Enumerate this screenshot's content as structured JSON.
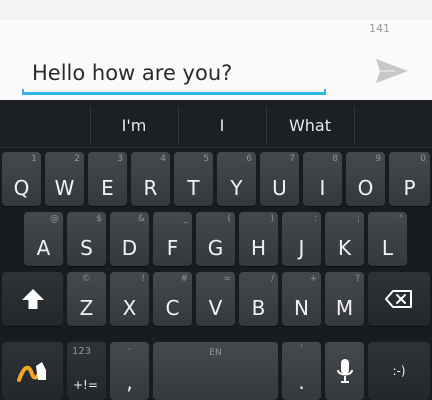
{
  "compose": {
    "char_counter": "141",
    "message_text": "Hello how are you?",
    "send_icon": "send-icon"
  },
  "keyboard": {
    "suggestions": [
      "I'm",
      "I",
      "What"
    ],
    "row1": [
      {
        "label": "Q",
        "hint": "1"
      },
      {
        "label": "W",
        "hint": "2"
      },
      {
        "label": "E",
        "hint": "3"
      },
      {
        "label": "R",
        "hint": "4"
      },
      {
        "label": "T",
        "hint": "5"
      },
      {
        "label": "Y",
        "hint": "6"
      },
      {
        "label": "U",
        "hint": "7"
      },
      {
        "label": "I",
        "hint": "8"
      },
      {
        "label": "O",
        "hint": "9"
      },
      {
        "label": "P",
        "hint": "0"
      }
    ],
    "row2": [
      {
        "label": "A",
        "hint": "@"
      },
      {
        "label": "S",
        "hint": "$"
      },
      {
        "label": "D",
        "hint": "&"
      },
      {
        "label": "F",
        "hint": "_"
      },
      {
        "label": "G",
        "hint": "("
      },
      {
        "label": "H",
        "hint": ")"
      },
      {
        "label": "J",
        "hint": ":"
      },
      {
        "label": "K",
        "hint": ";"
      },
      {
        "label": "L",
        "hint": "\""
      }
    ],
    "row3": [
      {
        "label": "Z",
        "hint": "©"
      },
      {
        "label": "X",
        "hint": "!"
      },
      {
        "label": "C",
        "hint": "#"
      },
      {
        "label": "V",
        "hint": "="
      },
      {
        "label": "B",
        "hint": "/"
      },
      {
        "label": "N",
        "hint": "+"
      },
      {
        "label": "M",
        "hint": "?"
      }
    ],
    "shift_icon": "shift-icon",
    "backspace_icon": "backspace-icon",
    "swype_icon": "swype-icon",
    "symbols": {
      "top": "123",
      "bottom": "+!="
    },
    "comma": {
      "label": ",",
      "hint": "-"
    },
    "space": {
      "hint": "EN"
    },
    "period": {
      "label": ".",
      "hint": "'"
    },
    "mic_icon": "microphone-icon",
    "emoticon": ":-)"
  },
  "colors": {
    "accent": "#33b5e5",
    "keyboard_bg": "#181b1f",
    "key_fg": "#f2f2f2",
    "hint_fg": "#8f959b"
  }
}
